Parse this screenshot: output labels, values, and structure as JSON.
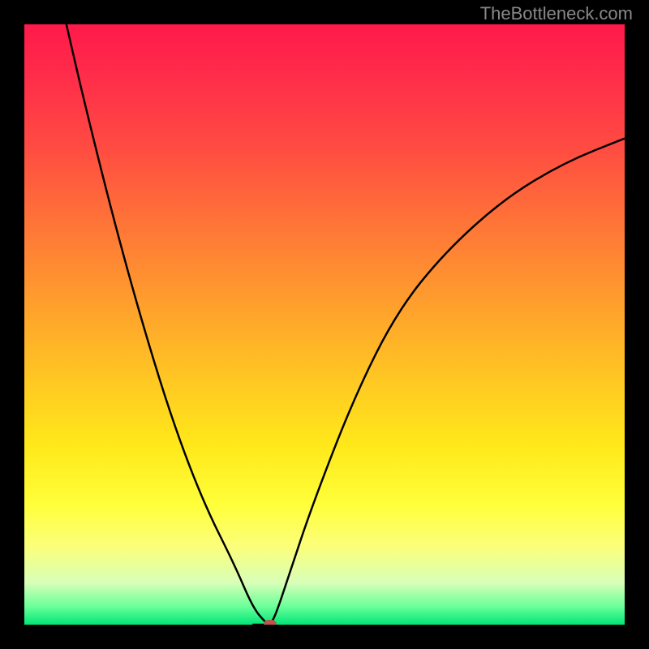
{
  "watermark": "TheBottleneck.com",
  "chart_data": {
    "type": "line",
    "title": "",
    "xlabel": "",
    "ylabel": "",
    "xlim": [
      0,
      100
    ],
    "ylim": [
      0,
      100
    ],
    "gradient_meaning": "vertical gradient from red (top, high bottleneck) to green (bottom, no bottleneck)",
    "series": [
      {
        "name": "left-branch",
        "x": [
          7,
          10,
          15,
          20,
          25,
          30,
          35,
          38,
          40,
          41
        ],
        "y": [
          100,
          87,
          67,
          49,
          33,
          20,
          10,
          3,
          0.5,
          0
        ]
      },
      {
        "name": "right-branch",
        "x": [
          41,
          42,
          44,
          48,
          55,
          62,
          70,
          80,
          90,
          100
        ],
        "y": [
          0,
          2,
          8,
          20,
          38,
          52,
          62,
          71,
          77,
          81
        ]
      }
    ],
    "marker": {
      "x": 41,
      "y": 0,
      "name": "optimal-point"
    },
    "colors": {
      "curve": "#000000",
      "marker": "#c0544a",
      "gradient_top": "#ff1a4a",
      "gradient_bottom": "#00e676",
      "frame": "#000000"
    }
  }
}
